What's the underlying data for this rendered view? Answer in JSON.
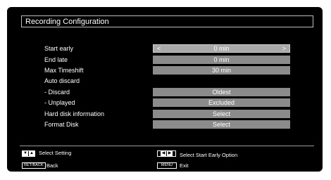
{
  "title": "Recording Configuration",
  "settings": [
    {
      "label": "Start early",
      "value": "0 min",
      "selected": true
    },
    {
      "label": "End late",
      "value": "0 min"
    },
    {
      "label": "Max Timeshift",
      "value": "30 min"
    },
    {
      "label": "Auto discard",
      "value": ""
    },
    {
      "label": "- Discard",
      "value": "Oldest"
    },
    {
      "label": "- Unplayed",
      "value": "Excluded"
    },
    {
      "label": "Hard disk information",
      "value": "Select"
    },
    {
      "label": "Format Disk",
      "value": "Select"
    }
  ],
  "footer": {
    "select_setting": "Select Setting",
    "back": "Back",
    "back_key": "RET/BACK",
    "select_option": "Select Start Early Option",
    "exit": "Exit",
    "exit_key": "MENU"
  }
}
